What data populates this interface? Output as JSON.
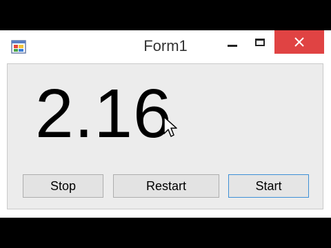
{
  "window": {
    "title": "Form1",
    "icon": "form-app-icon",
    "controls": {
      "minimize": "minimize-icon",
      "maximize": "maximize-icon",
      "close": "close-icon"
    },
    "close_color": "#e04343"
  },
  "timer": {
    "value": "2.16"
  },
  "buttons": {
    "stop": "Stop",
    "restart": "Restart",
    "start": "Start"
  },
  "colors": {
    "focus_border": "#3c8fd6",
    "client_bg": "#ececec"
  }
}
